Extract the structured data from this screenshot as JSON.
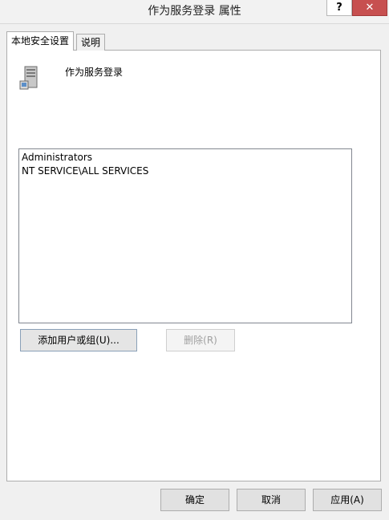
{
  "window": {
    "title": "作为服务登录 属性",
    "help_label": "?",
    "close_label": "✕"
  },
  "tabs": [
    {
      "label": "本地安全设置",
      "active": true
    },
    {
      "label": "说明",
      "active": false
    }
  ],
  "policy": {
    "icon": "server-icon",
    "name": "作为服务登录"
  },
  "accounts": [
    "Administrators",
    "NT SERVICE\\ALL SERVICES"
  ],
  "buttons": {
    "add": "添加用户或组(U)...",
    "remove": "删除(R)",
    "ok": "确定",
    "cancel": "取消",
    "apply": "应用(A)"
  }
}
